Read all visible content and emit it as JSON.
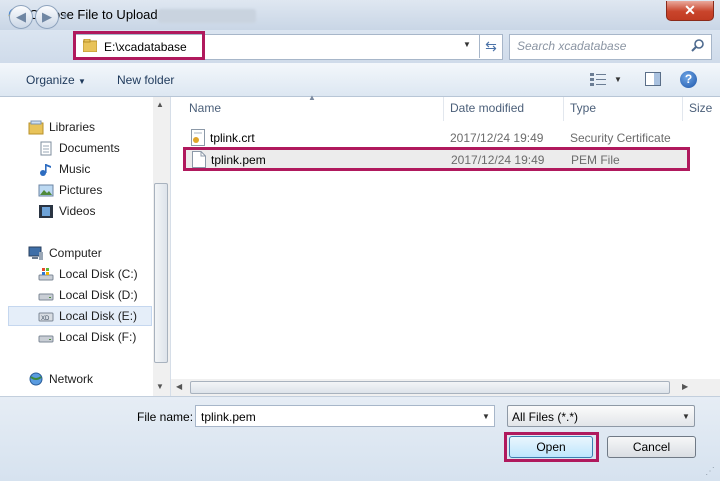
{
  "window": {
    "title": "Choose File to Upload",
    "close_label": "✕"
  },
  "address": {
    "path": "E:\\xcadatabase",
    "search_placeholder": "Search xcadatabase"
  },
  "toolbar": {
    "organize_label": "Organize",
    "new_folder_label": "New folder"
  },
  "nav": {
    "favorites_groups": [
      {
        "label": "Libraries",
        "icon": "libraries-icon"
      },
      {
        "label": "Documents",
        "icon": "documents-icon"
      },
      {
        "label": "Music",
        "icon": "music-icon"
      },
      {
        "label": "Pictures",
        "icon": "pictures-icon"
      },
      {
        "label": "Videos",
        "icon": "videos-icon"
      },
      {
        "label": "Computer",
        "icon": "computer-icon"
      },
      {
        "label": "Local Disk (C:)",
        "icon": "disk-c-icon"
      },
      {
        "label": "Local Disk (D:)",
        "icon": "disk-icon"
      },
      {
        "label": "Local Disk (E:)",
        "icon": "disk-e-icon",
        "selected": true
      },
      {
        "label": "Local Disk (F:)",
        "icon": "disk-icon"
      },
      {
        "label": "Network",
        "icon": "network-icon"
      }
    ]
  },
  "columns": {
    "name": "Name",
    "date": "Date modified",
    "type": "Type",
    "size": "Size"
  },
  "files": [
    {
      "name": "tplink.crt",
      "date": "2017/12/24 19:49",
      "type": "Security Certificate",
      "icon": "certificate-file-icon"
    },
    {
      "name": "tplink.pem",
      "date": "2017/12/24 19:49",
      "type": "PEM File",
      "icon": "blank-file-icon",
      "selected": true
    }
  ],
  "bottom": {
    "file_name_label": "File name:",
    "file_name_value": "tplink.pem",
    "filter_value": "All Files (*.*)",
    "open_label": "Open",
    "cancel_label": "Cancel"
  },
  "colors": {
    "highlight": "#b0195d",
    "accent": "#1e395b"
  }
}
